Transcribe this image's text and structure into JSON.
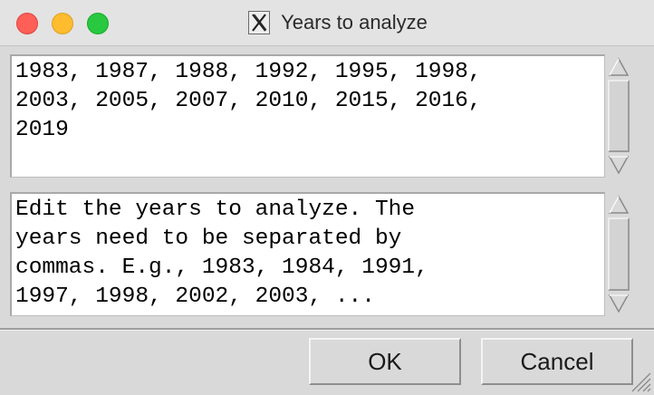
{
  "window": {
    "title": "Years to analyze",
    "app_icon": "x-window-icon",
    "title_buttons": [
      "close",
      "minimize",
      "zoom"
    ]
  },
  "years_pane": {
    "lines": [
      "1983, 1987, 1988, 1992, 1995, 1998,",
      "2003, 2005, 2007, 2010, 2015, 2016,",
      "2019"
    ]
  },
  "help_pane": {
    "lines": [
      "Edit the years to analyze. The",
      "years need to be separated by",
      "commas. E.g., 1983, 1984, 1991,",
      "1997, 1998, 2002, 2003, ..."
    ]
  },
  "buttons": {
    "ok_label": "OK",
    "cancel_label": "Cancel"
  },
  "colors": {
    "close": "#fe5f57",
    "minimize": "#febc2e",
    "zoom": "#28c840",
    "background": "#d9d9d9"
  }
}
